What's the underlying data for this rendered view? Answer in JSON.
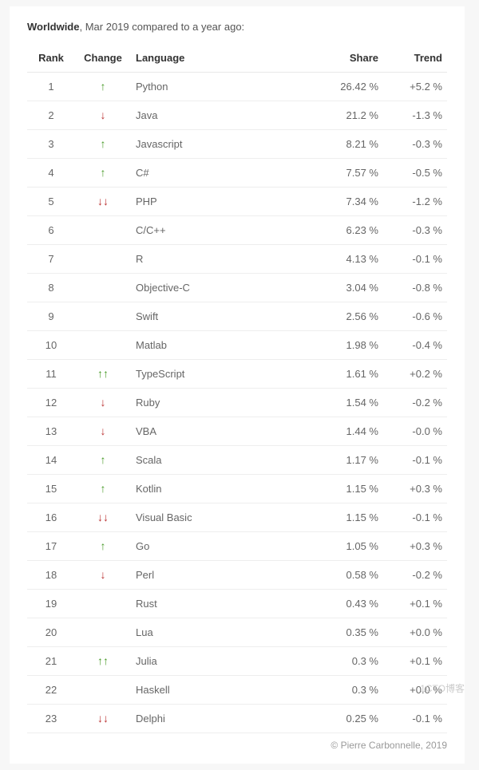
{
  "caption": {
    "strong": "Worldwide",
    "rest": ", Mar 2019 compared to a year ago:"
  },
  "headers": {
    "rank": "Rank",
    "change": "Change",
    "language": "Language",
    "share": "Share",
    "trend": "Trend"
  },
  "rows": [
    {
      "rank": "1",
      "change": "up",
      "language": "Python",
      "share": "26.42 %",
      "trend": "+5.2 %"
    },
    {
      "rank": "2",
      "change": "down",
      "language": "Java",
      "share": "21.2 %",
      "trend": "-1.3 %"
    },
    {
      "rank": "3",
      "change": "up",
      "language": "Javascript",
      "share": "8.21 %",
      "trend": "-0.3 %"
    },
    {
      "rank": "4",
      "change": "up",
      "language": "C#",
      "share": "7.57 %",
      "trend": "-0.5 %"
    },
    {
      "rank": "5",
      "change": "down-down",
      "language": "PHP",
      "share": "7.34 %",
      "trend": "-1.2 %"
    },
    {
      "rank": "6",
      "change": "",
      "language": "C/C++",
      "share": "6.23 %",
      "trend": "-0.3 %"
    },
    {
      "rank": "7",
      "change": "",
      "language": "R",
      "share": "4.13 %",
      "trend": "-0.1 %"
    },
    {
      "rank": "8",
      "change": "",
      "language": "Objective-C",
      "share": "3.04 %",
      "trend": "-0.8 %"
    },
    {
      "rank": "9",
      "change": "",
      "language": "Swift",
      "share": "2.56 %",
      "trend": "-0.6 %"
    },
    {
      "rank": "10",
      "change": "",
      "language": "Matlab",
      "share": "1.98 %",
      "trend": "-0.4 %"
    },
    {
      "rank": "11",
      "change": "up-up",
      "language": "TypeScript",
      "share": "1.61 %",
      "trend": "+0.2 %"
    },
    {
      "rank": "12",
      "change": "down",
      "language": "Ruby",
      "share": "1.54 %",
      "trend": "-0.2 %"
    },
    {
      "rank": "13",
      "change": "down",
      "language": "VBA",
      "share": "1.44 %",
      "trend": "-0.0 %"
    },
    {
      "rank": "14",
      "change": "up",
      "language": "Scala",
      "share": "1.17 %",
      "trend": "-0.1 %"
    },
    {
      "rank": "15",
      "change": "up",
      "language": "Kotlin",
      "share": "1.15 %",
      "trend": "+0.3 %"
    },
    {
      "rank": "16",
      "change": "down-down",
      "language": "Visual Basic",
      "share": "1.15 %",
      "trend": "-0.1 %"
    },
    {
      "rank": "17",
      "change": "up",
      "language": "Go",
      "share": "1.05 %",
      "trend": "+0.3 %"
    },
    {
      "rank": "18",
      "change": "down",
      "language": "Perl",
      "share": "0.58 %",
      "trend": "-0.2 %"
    },
    {
      "rank": "19",
      "change": "",
      "language": "Rust",
      "share": "0.43 %",
      "trend": "+0.1 %"
    },
    {
      "rank": "20",
      "change": "",
      "language": "Lua",
      "share": "0.35 %",
      "trend": "+0.0 %"
    },
    {
      "rank": "21",
      "change": "up-up",
      "language": "Julia",
      "share": "0.3 %",
      "trend": "+0.1 %"
    },
    {
      "rank": "22",
      "change": "",
      "language": "Haskell",
      "share": "0.3 %",
      "trend": "+0.0 %"
    },
    {
      "rank": "23",
      "change": "down-down",
      "language": "Delphi",
      "share": "0.25 %",
      "trend": "-0.1 %"
    }
  ],
  "footer": "© Pierre Carbonnelle, 2019",
  "watermark": "1CTO博客",
  "arrows": {
    "up": "↑",
    "down": "↓"
  }
}
